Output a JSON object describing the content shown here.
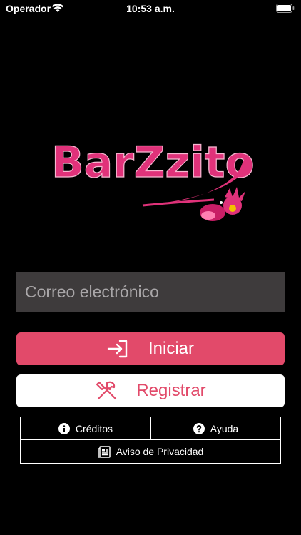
{
  "status_bar": {
    "carrier": "Operador",
    "time": "10:53 a.m.",
    "icons": [
      "wifi-icon",
      "battery-icon"
    ]
  },
  "logo": {
    "text": "BarZzito",
    "color": "#e0327a"
  },
  "login_form": {
    "email_placeholder": "Correo electrónico",
    "email_value": ""
  },
  "buttons": {
    "login_label": "Iniciar",
    "login_icon": "sign-in-icon",
    "register_label": "Registrar",
    "register_icon": "tools-icon"
  },
  "links": {
    "credits_label": "Créditos",
    "credits_icon": "info-circle-icon",
    "help_label": "Ayuda",
    "help_icon": "question-circle-icon",
    "privacy_label": "Aviso de Privacidad",
    "privacy_icon": "document-icon"
  },
  "colors": {
    "background": "#000000",
    "accent": "#e24a6a",
    "input_background": "#3e3b3c"
  }
}
